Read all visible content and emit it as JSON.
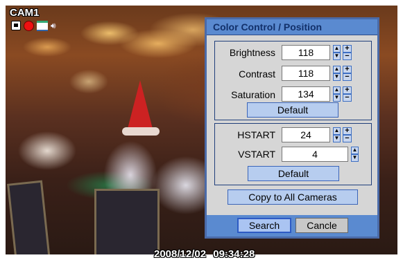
{
  "camera": {
    "name": "CAM1"
  },
  "status_icons": [
    "lock-icon",
    "record-icon",
    "network-icon",
    "audio-icon"
  ],
  "timestamp": {
    "date": "2008/12/02",
    "time": "09:34:28"
  },
  "dialog": {
    "title": "Color Control / Position",
    "color": {
      "brightness": {
        "label": "Brightness",
        "value": "118"
      },
      "contrast": {
        "label": "Contrast",
        "value": "118"
      },
      "saturation": {
        "label": "Saturation",
        "value": "134"
      },
      "default_label": "Default"
    },
    "position": {
      "hstart": {
        "label": "HSTART",
        "value": "24"
      },
      "vstart": {
        "label": "VSTART",
        "value": "4"
      },
      "default_label": "Default"
    },
    "copy_label": "Copy to All Cameras",
    "search_label": "Search",
    "cancel_label": "Cancle"
  },
  "colors": {
    "dialog_bg": "#d6d6d6",
    "title_bar": "#5a8ad0",
    "button": "#b7cdef",
    "border": "#3a64b8"
  }
}
